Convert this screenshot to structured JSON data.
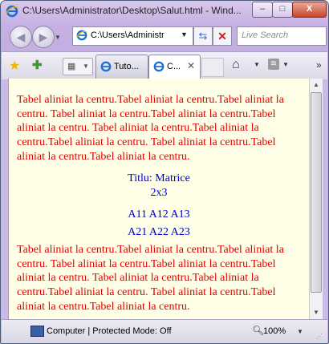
{
  "window": {
    "title": "C:\\Users\\Administrator\\Desktop\\Salut.html - Wind...",
    "controls": {
      "minimize": "–",
      "maximize": "□",
      "close": "X"
    }
  },
  "nav": {
    "address": "C:\\Users\\Administr",
    "search_placeholder": "Live Search"
  },
  "tabs": [
    {
      "label": "Tuto..."
    },
    {
      "label": "C..."
    }
  ],
  "page": {
    "paragraph_text": "Tabel aliniat la centru.Tabel aliniat la centru.Tabel aliniat la centru. Tabel aliniat la centru.Tabel aliniat la centru.Tabel aliniat la centru. Tabel aliniat la centru.Tabel aliniat la centru.Tabel aliniat la centru. Tabel aliniat la centru.Tabel aliniat la centru.Tabel aliniat la centru.",
    "caption_line1": "Titlu: Matrice",
    "caption_line2": "2x3",
    "row1": "A11 A12 A13",
    "row2": "A21 A22 A23"
  },
  "status": {
    "zone": "Computer | Protected Mode: Off",
    "zoom": "100%"
  },
  "colors": {
    "paragraph": "#e00000",
    "table_text": "#0000cc",
    "page_background": "#ffffe7"
  }
}
